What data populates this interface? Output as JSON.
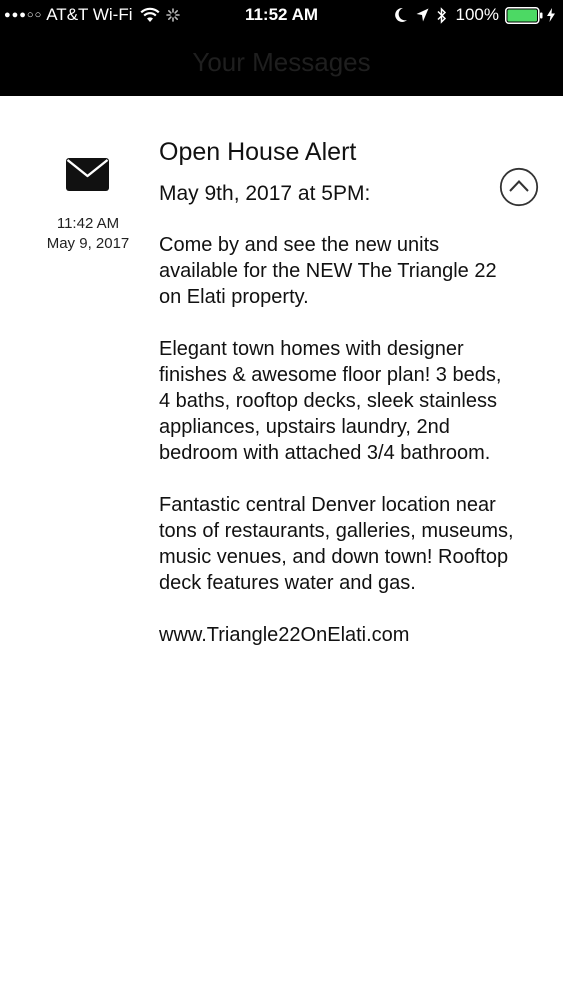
{
  "status_bar": {
    "signal_dots": "●●●○○",
    "carrier": "AT&T Wi-Fi",
    "time": "11:52 AM",
    "battery_percent": "100%"
  },
  "header": {
    "title": "Your Messages"
  },
  "message": {
    "icon": "envelope-icon",
    "time": "11:42 AM",
    "date": "May 9, 2017",
    "title": "Open House Alert",
    "subtitle": "May 9th, 2017 at 5PM:",
    "paragraphs": [
      "Come by and see the new units available for the NEW The Triangle 22 on Elati property.",
      "Elegant town homes with designer finishes & awesome floor plan! 3 beds, 4 baths, rooftop decks, sleek stainless appliances, upstairs laundry, 2nd bedroom with attached 3/4 bathroom.",
      "Fantastic central Denver location near tons of restaurants, galleries, museums, music venues, and down town! Rooftop deck features water and gas."
    ],
    "link": "www.Triangle22OnElati.com"
  },
  "colors": {
    "header_background": "#000000",
    "battery_green": "#4cd964",
    "text": "#111111"
  }
}
